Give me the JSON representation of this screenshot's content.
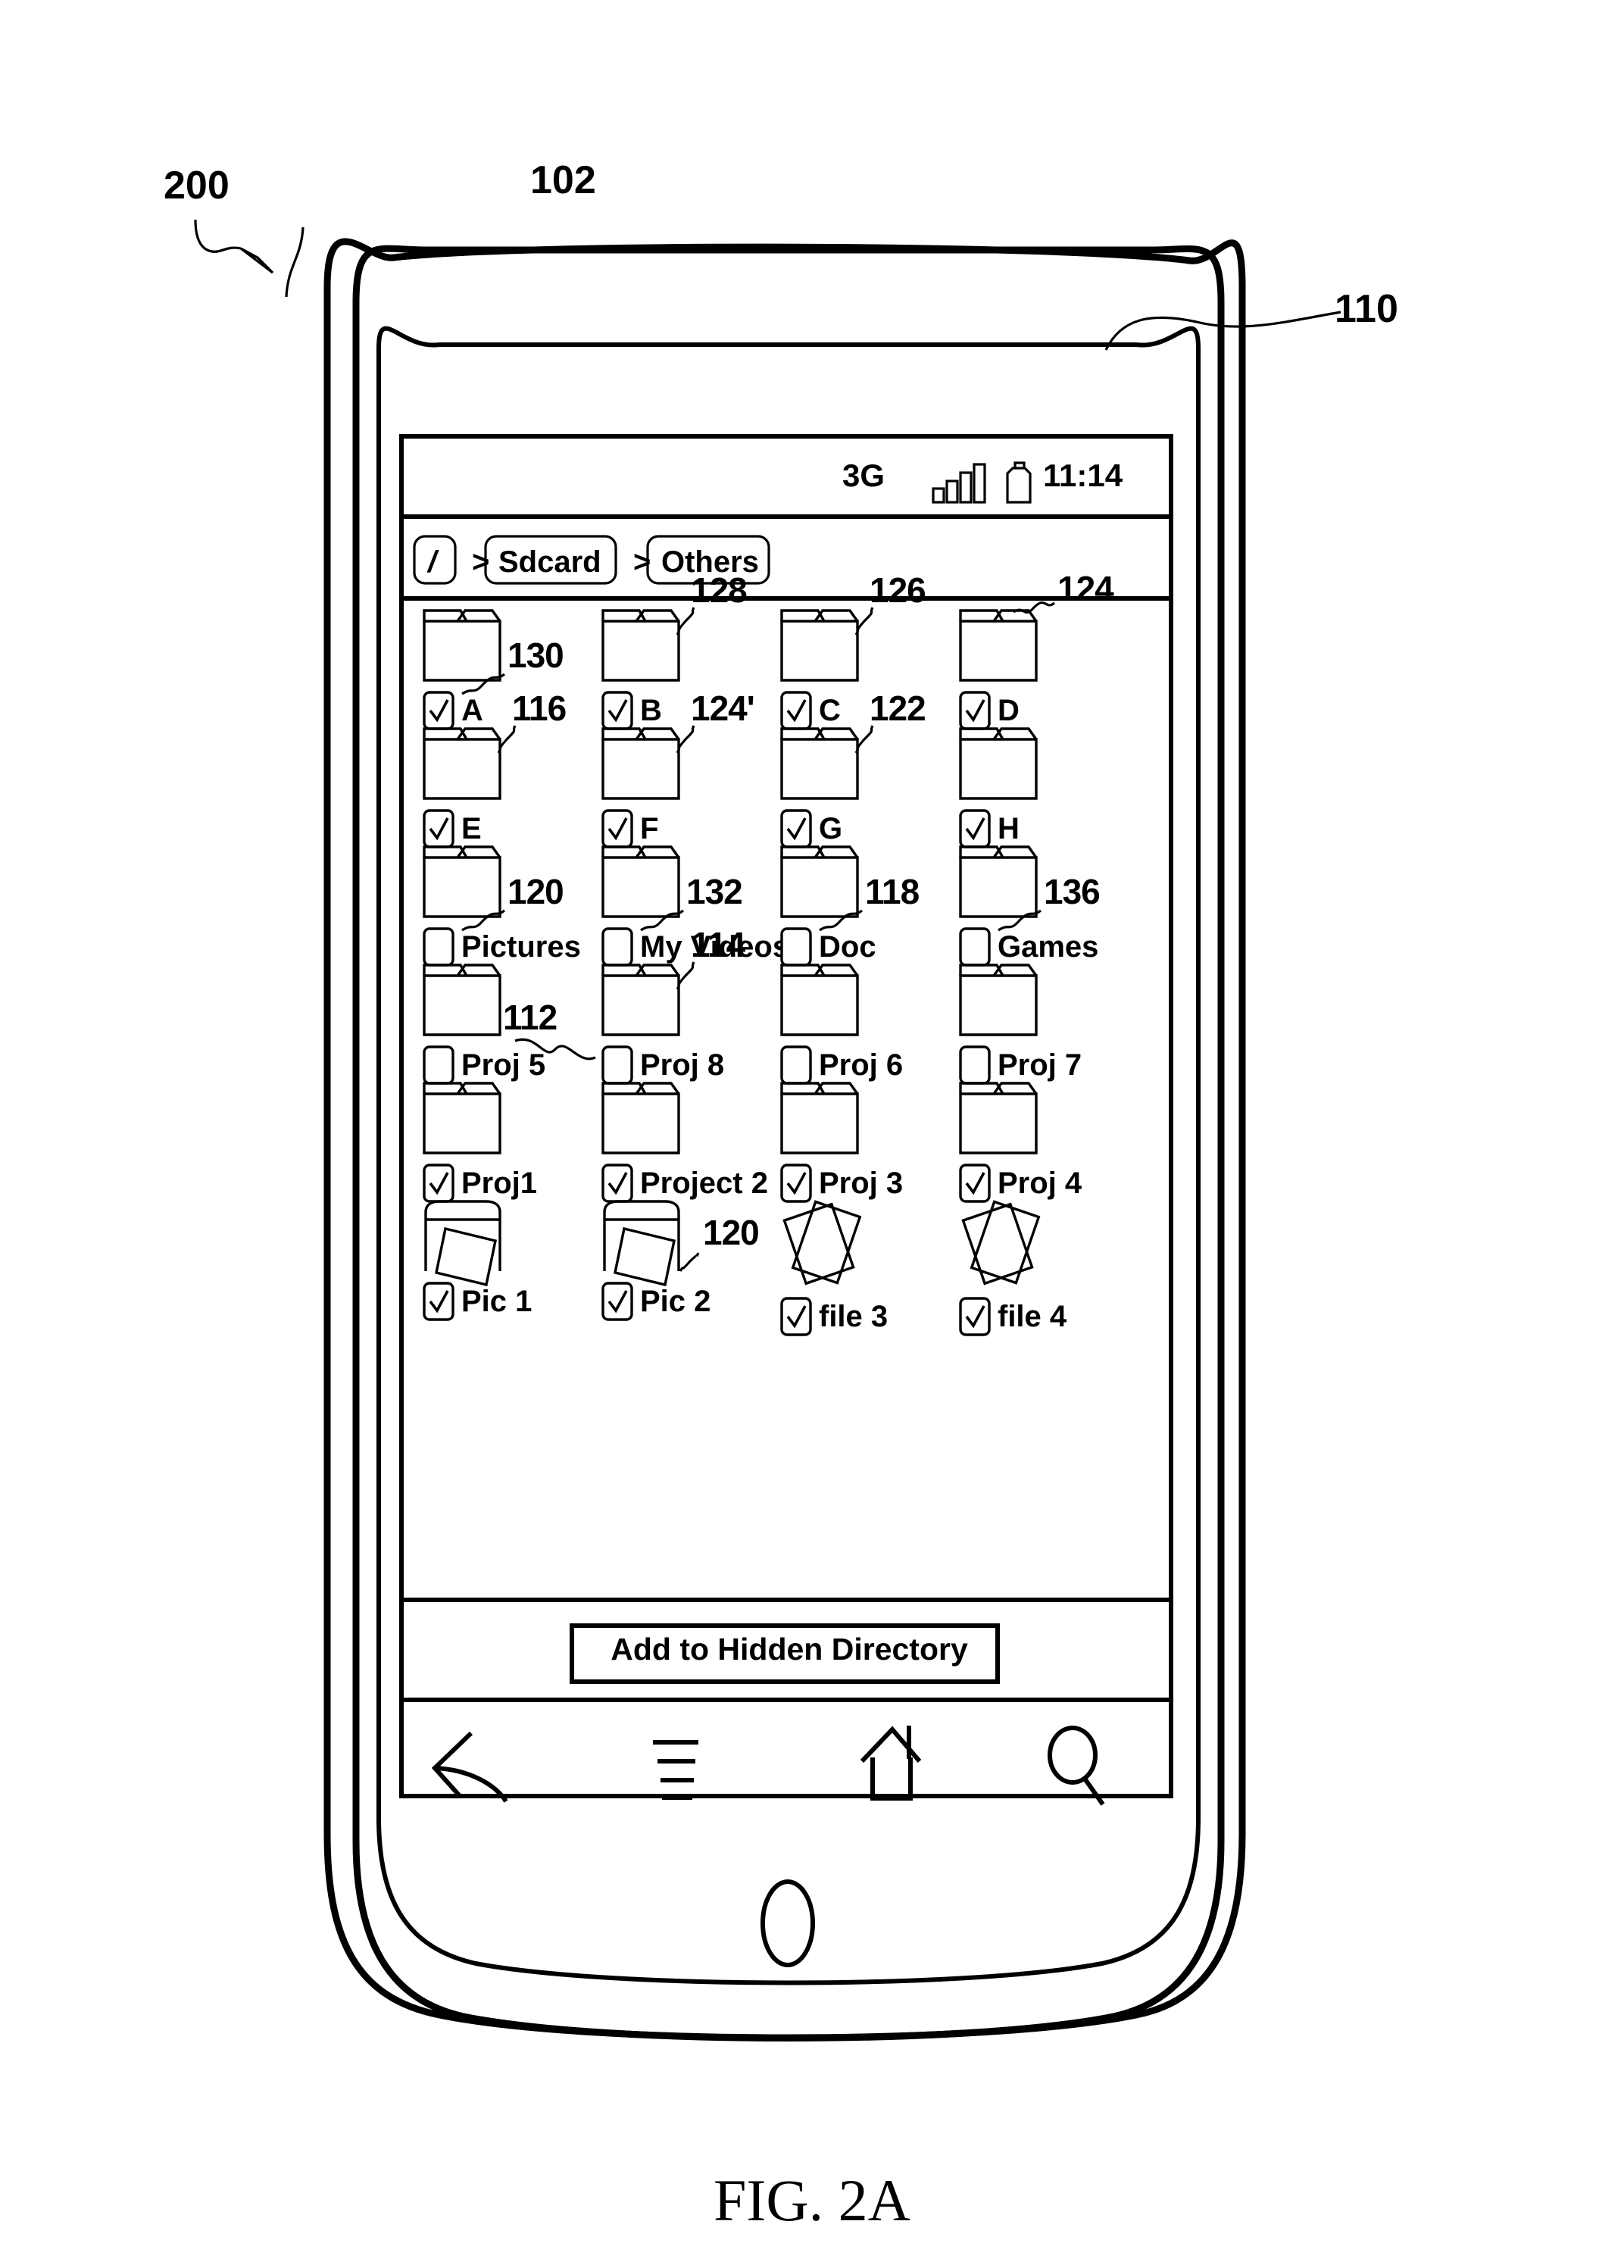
{
  "figure": {
    "caption": "FIG. 2A",
    "device_ref": "200",
    "refs": {
      "body": "102",
      "bezel": "110"
    }
  },
  "status_bar": {
    "network": "3G",
    "signal_icon": "signal-bars-icon",
    "battery_icon": "battery-icon",
    "time": "11:14"
  },
  "breadcrumb": {
    "separator": ">",
    "items": [
      {
        "label": "/"
      },
      {
        "label": "Sdcard"
      },
      {
        "label": "Others"
      }
    ]
  },
  "grid": {
    "rows": [
      {
        "items": [
          {
            "label": "A",
            "icon": "folder-icon",
            "checked": true,
            "ref": "130",
            "ref_pos": "right-of-icon-low"
          },
          {
            "label": "B",
            "icon": "folder-icon",
            "checked": true,
            "ref": "128",
            "ref_pos": "above-right"
          },
          {
            "label": "C",
            "icon": "folder-icon",
            "checked": true,
            "ref": "126",
            "ref_pos": "above-right"
          },
          {
            "label": "D",
            "icon": "folder-icon",
            "checked": true,
            "ref": "124",
            "ref_pos": "above-right-short"
          }
        ]
      },
      {
        "items": [
          {
            "label": "E",
            "icon": "folder-icon",
            "checked": true,
            "ref": "116",
            "ref_pos": "above-right"
          },
          {
            "label": "F",
            "icon": "folder-icon",
            "checked": true,
            "ref": "124'",
            "ref_pos": "above-right"
          },
          {
            "label": "G",
            "icon": "folder-icon",
            "checked": true,
            "ref": "122",
            "ref_pos": "above-right"
          },
          {
            "label": "H",
            "icon": "folder-icon",
            "checked": true,
            "ref": null,
            "ref_pos": null
          }
        ]
      },
      {
        "items": [
          {
            "label": "Pictures",
            "icon": "folder-icon",
            "checked": false,
            "ref": "120",
            "ref_pos": "right-of-icon-low"
          },
          {
            "label": "My Videos",
            "icon": "folder-icon",
            "checked": false,
            "ref": "132",
            "ref_pos": "right-of-icon-low"
          },
          {
            "label": "Doc",
            "icon": "folder-icon",
            "checked": false,
            "ref": "118",
            "ref_pos": "right-of-icon-low"
          },
          {
            "label": "Games",
            "icon": "folder-icon",
            "checked": false,
            "ref": "136",
            "ref_pos": "right-of-icon-low"
          }
        ]
      },
      {
        "items": [
          {
            "label": "Proj 5",
            "icon": "folder-icon",
            "checked": false,
            "ref": "112",
            "ref_pos": "right-to-next-checkbox"
          },
          {
            "label": "Proj 8",
            "icon": "folder-icon",
            "checked": false,
            "ref": "114",
            "ref_pos": "above-right"
          },
          {
            "label": "Proj 6",
            "icon": "folder-icon",
            "checked": false,
            "ref": null,
            "ref_pos": null
          },
          {
            "label": "Proj 7",
            "icon": "folder-icon",
            "checked": false,
            "ref": null,
            "ref_pos": null
          }
        ]
      },
      {
        "items": [
          {
            "label": "Proj1",
            "icon": "folder-icon",
            "checked": true,
            "ref": null,
            "ref_pos": null
          },
          {
            "label": "Project 2",
            "icon": "folder-icon",
            "checked": true,
            "ref": null,
            "ref_pos": null
          },
          {
            "label": "Proj 3",
            "icon": "folder-icon",
            "checked": true,
            "ref": null,
            "ref_pos": null
          },
          {
            "label": "Proj 4",
            "icon": "folder-icon",
            "checked": true,
            "ref": null,
            "ref_pos": null
          }
        ]
      },
      {
        "items": [
          {
            "label": "Pic 1",
            "icon": "photo-album-icon",
            "checked": true,
            "ref": null,
            "ref_pos": null
          },
          {
            "label": "Pic 2",
            "icon": "photo-album-icon",
            "checked": true,
            "ref": "120",
            "ref_pos": "right-of-icon-mid"
          },
          {
            "label": "file 3",
            "icon": "stacked-papers-icon",
            "checked": true,
            "ref": null,
            "ref_pos": null
          },
          {
            "label": "file 4",
            "icon": "stacked-papers-icon",
            "checked": true,
            "ref": null,
            "ref_pos": null
          }
        ]
      }
    ]
  },
  "action_bar": {
    "button_label": "Add to Hidden Directory"
  },
  "nav_bar": {
    "buttons": [
      {
        "icon": "back-arrow-icon"
      },
      {
        "icon": "menu-icon"
      },
      {
        "icon": "home-icon"
      },
      {
        "icon": "search-icon"
      }
    ]
  },
  "home_button": {
    "icon": "home-hardware-button"
  },
  "colors": {
    "stroke": "#000000",
    "background": "#ffffff"
  }
}
